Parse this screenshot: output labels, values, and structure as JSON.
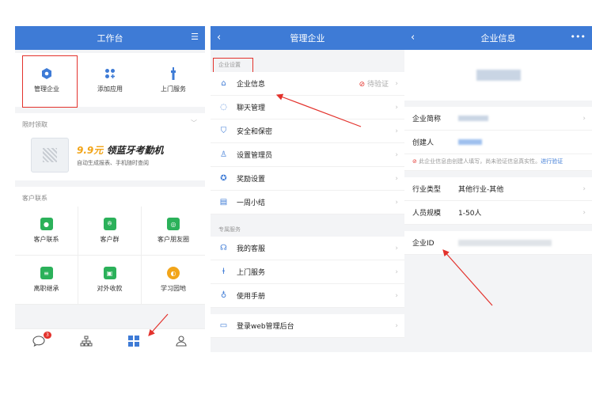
{
  "panel1": {
    "title": "工作台",
    "header_right_icon": "menu-sort-icon",
    "quick": [
      {
        "label": "管理企业",
        "icon": "manage-enterprise-icon",
        "color": "#3e7bd6"
      },
      {
        "label": "添加应用",
        "icon": "add-app-icon",
        "color": "#3e7bd6"
      },
      {
        "label": "上门服务",
        "icon": "door-service-icon",
        "color": "#3e7bd6"
      }
    ],
    "promo_section": "限时领取",
    "promo": {
      "price": "9.9元",
      "title": "领蓝牙考勤机",
      "subtitle": "自动生成报表、手机随时查阅"
    },
    "contacts_section": "客户联系",
    "contacts": [
      {
        "label": "客户联系",
        "icon": "chat-bubble-icon",
        "color": "#2bb15a"
      },
      {
        "label": "客户群",
        "icon": "customer-group-icon",
        "color": "#2bb15a"
      },
      {
        "label": "客户朋友圈",
        "icon": "moments-icon",
        "color": "#2bb15a"
      },
      {
        "label": "离职继承",
        "icon": "resign-inherit-icon",
        "color": "#2bb15a"
      },
      {
        "label": "对外收款",
        "icon": "payment-icon",
        "color": "#2bb15a"
      },
      {
        "label": "学习园地",
        "icon": "planet-icon",
        "color": "#f2a51a"
      }
    ],
    "tabbar": {
      "badge": "3"
    }
  },
  "panel2": {
    "title": "管理企业",
    "section1": "企业设置",
    "items1": [
      {
        "label": "企业信息",
        "status": "待验证"
      },
      {
        "label": "聊天管理"
      },
      {
        "label": "安全和保密"
      },
      {
        "label": "设置管理员"
      },
      {
        "label": "奖励设置"
      },
      {
        "label": "一周小结"
      }
    ],
    "section2": "专属服务",
    "items2": [
      {
        "label": "我的客服"
      },
      {
        "label": "上门服务"
      },
      {
        "label": "使用手册"
      }
    ],
    "items3": [
      {
        "label": "登录web管理后台"
      }
    ]
  },
  "panel3": {
    "title": "企业信息",
    "more": "•••",
    "short_name_label": "企业简称",
    "creator_label": "创建人",
    "notice_text": "此企业信息由创建人填写，尚未验证信息真实性。",
    "notice_link": "进行验证",
    "industry_label": "行业类型",
    "industry_value": "其他行业-其他",
    "size_label": "人员规模",
    "size_value": "1-50人",
    "id_label": "企业ID"
  },
  "colors": {
    "brand": "#3e7bd6",
    "annotation": "#e3322c",
    "green": "#2bb15a",
    "orange": "#f2a51a"
  }
}
